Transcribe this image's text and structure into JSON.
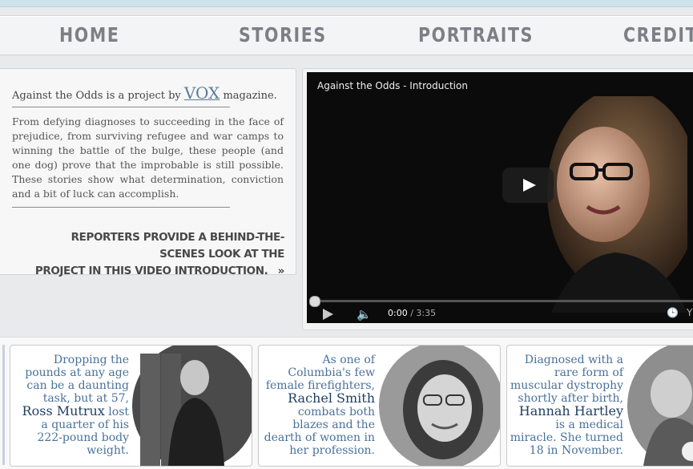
{
  "nav": {
    "home": "HOME",
    "stories": "STORIES",
    "portraits": "PORTRAITS",
    "credits": "CREDITS"
  },
  "intro": {
    "line_prefix": "Against the Odds is a project by",
    "brand": "VOX",
    "line_suffix": "magazine.",
    "body": "From defying diagnoses to succeeding in the face of prejudice, from surviving refugee and war camps to winning the battle of the bulge, these people (and one dog) prove that the improbable is still possible. These stories show what determination, conviction and a bit of luck can accomplish.",
    "cta_line1": "REPORTERS PROVIDE A BEHIND-THE-SCENES LOOK AT THE",
    "cta_line2": "PROJECT IN THIS VIDEO INTRODUCTION.",
    "cta_arrow": "»"
  },
  "video": {
    "title": "Against the Odds - Introduction",
    "current_time": "0:00",
    "duration": "/ 3:35",
    "progress": 0,
    "icons": [
      "play-icon",
      "volume-icon",
      "clock-icon"
    ],
    "yt": "Y"
  },
  "stories": [
    {
      "pre": "Dropping the pounds at any age can be a daunting task, but at 57,",
      "name": "Ross Mutrux",
      "post": "lost a quarter of his 222-pound body weight."
    },
    {
      "pre": "As one of Columbia's few female firefighters,",
      "name": "Rachel Smith",
      "post": "combats both blazes and the dearth of women in her profession."
    },
    {
      "pre": "Diagnosed with a rare form of muscular dystrophy shortly after birth,",
      "name": "Hannah Hartley",
      "post": "is a medical miracle. She turned 18 in November."
    }
  ],
  "colors": {
    "accent_text": "#49719b",
    "name_text": "#1f3f63",
    "nav_text": "#7c8086",
    "video_bg": "#0b0b0b"
  }
}
